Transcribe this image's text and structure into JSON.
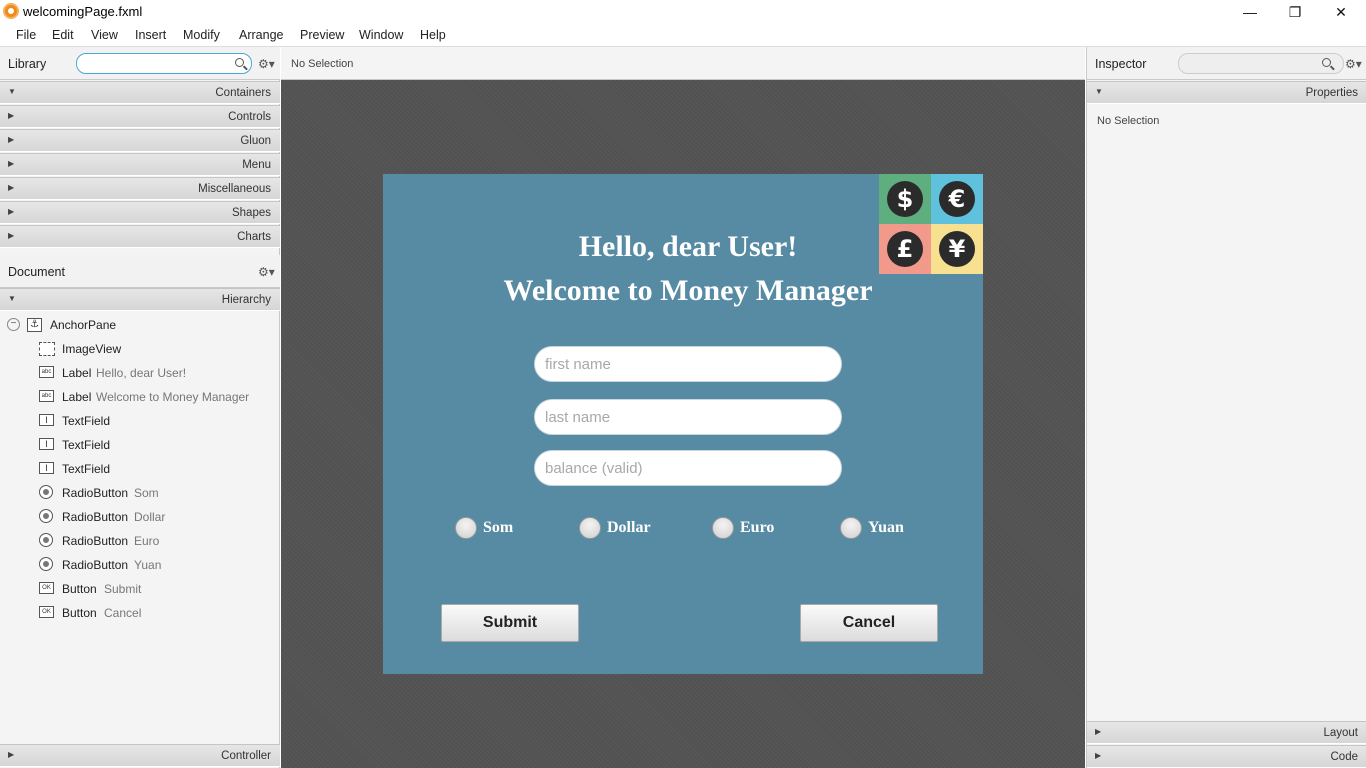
{
  "window": {
    "title": "welcomingPage.fxml",
    "minimize": "—",
    "restore": "❐",
    "close": "✕"
  },
  "menu": [
    "File",
    "Edit",
    "View",
    "Insert",
    "Modify",
    "Arrange",
    "Preview",
    "Window",
    "Help"
  ],
  "library": {
    "title": "Library",
    "search_placeholder": "",
    "sections": [
      "Containers",
      "Controls",
      "Gluon",
      "Menu",
      "Miscellaneous",
      "Shapes",
      "Charts"
    ]
  },
  "document": {
    "title": "Document",
    "hierarchy_label": "Hierarchy",
    "controller_label": "Controller",
    "tree": [
      {
        "type": "AnchorPane",
        "text": "",
        "icon": "anchor-icon"
      },
      {
        "type": "ImageView",
        "text": "",
        "icon": "imageview-icon"
      },
      {
        "type": "Label",
        "text": "Hello, dear User!",
        "icon": "label-icon"
      },
      {
        "type": "Label",
        "text": "Welcome to Money Manager",
        "icon": "label-icon"
      },
      {
        "type": "TextField",
        "text": "",
        "icon": "textfield-icon"
      },
      {
        "type": "TextField",
        "text": "",
        "icon": "textfield-icon"
      },
      {
        "type": "TextField",
        "text": "",
        "icon": "textfield-icon"
      },
      {
        "type": "RadioButton",
        "text": "Som",
        "icon": "radiobutton-icon"
      },
      {
        "type": "RadioButton",
        "text": "Dollar",
        "icon": "radiobutton-icon"
      },
      {
        "type": "RadioButton",
        "text": "Euro",
        "icon": "radiobutton-icon"
      },
      {
        "type": "RadioButton",
        "text": "Yuan",
        "icon": "radiobutton-icon"
      },
      {
        "type": "Button",
        "text": "Submit",
        "icon": "button-icon"
      },
      {
        "type": "Button",
        "text": "Cancel",
        "icon": "button-icon"
      }
    ]
  },
  "center": {
    "status": "No Selection"
  },
  "form": {
    "greeting": "Hello, dear User!",
    "welcome": "Welcome to Money Manager",
    "first_name_placeholder": "first name",
    "last_name_placeholder": "last name",
    "balance_placeholder": "balance (valid)",
    "radios": [
      "Som",
      "Dollar",
      "Euro",
      "Yuan"
    ],
    "submit": "Submit",
    "cancel": "Cancel",
    "coins": [
      {
        "symbol": "$",
        "bg": "#5fae80"
      },
      {
        "symbol": "€",
        "bg": "#5fc1dc"
      },
      {
        "symbol": "£",
        "bg": "#f1998a"
      },
      {
        "symbol": "¥",
        "bg": "#f7e08f"
      }
    ]
  },
  "inspector": {
    "title": "Inspector",
    "properties_label": "Properties",
    "no_selection": "No Selection",
    "layout_label": "Layout",
    "code_label": "Code"
  }
}
